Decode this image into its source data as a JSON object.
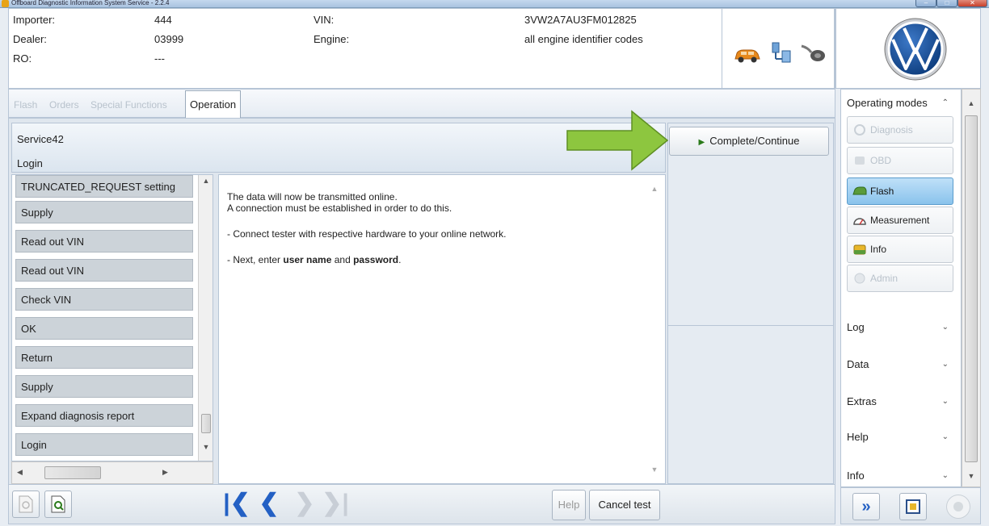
{
  "window": {
    "title": "Offboard Diagnostic Information System Service - 2.2.4"
  },
  "header": {
    "importer_label": "Importer:",
    "importer_value": "444",
    "dealer_label": "Dealer:",
    "dealer_value": "03999",
    "ro_label": "RO:",
    "ro_value": "---",
    "vin_label": "VIN:",
    "vin_value": "3VW2A7AU3FM012825",
    "engine_label": "Engine:",
    "engine_value": "all engine identifier codes"
  },
  "tabs": [
    {
      "label": "Flash",
      "active": false
    },
    {
      "label": "Orders",
      "active": false
    },
    {
      "label": "Special Functions",
      "active": false
    },
    {
      "label": "Operation",
      "active": true
    }
  ],
  "service": {
    "name": "Service42",
    "step": "Login"
  },
  "steps": [
    "TRUNCATED_REQUEST setting",
    "Supply",
    "Read out VIN",
    "Read out VIN",
    "Check VIN",
    "OK",
    "Return",
    "Supply",
    "Expand diagnosis report",
    "Login"
  ],
  "content": {
    "line1": "The data will now be transmitted online.",
    "line2": "A connection must be established in order to do this.",
    "line3": "- Connect tester with respective hardware to your online network.",
    "line4_prefix": "- Next, enter ",
    "line4_bold1": "user name",
    "line4_mid": " and ",
    "line4_bold2": "password",
    "line4_suffix": "."
  },
  "actions": {
    "complete_continue": "Complete/Continue",
    "help": "Help",
    "cancel_test": "Cancel test"
  },
  "sidebar": {
    "operating_modes_label": "Operating modes",
    "modes": [
      {
        "label": "Diagnosis",
        "state": "disabled"
      },
      {
        "label": "OBD",
        "state": "disabled"
      },
      {
        "label": "Flash",
        "state": "active"
      },
      {
        "label": "Measurement",
        "state": "enabled"
      },
      {
        "label": "Info",
        "state": "enabled"
      },
      {
        "label": "Admin",
        "state": "disabled"
      }
    ],
    "sections": [
      "Log",
      "Data",
      "Extras",
      "Help",
      "Info"
    ]
  },
  "colors": {
    "arrow_green": "#8dc63f",
    "active_mode": "#8ac3ec",
    "step_bg": "#ccd3d9",
    "nav_blue": "#2360c4"
  }
}
